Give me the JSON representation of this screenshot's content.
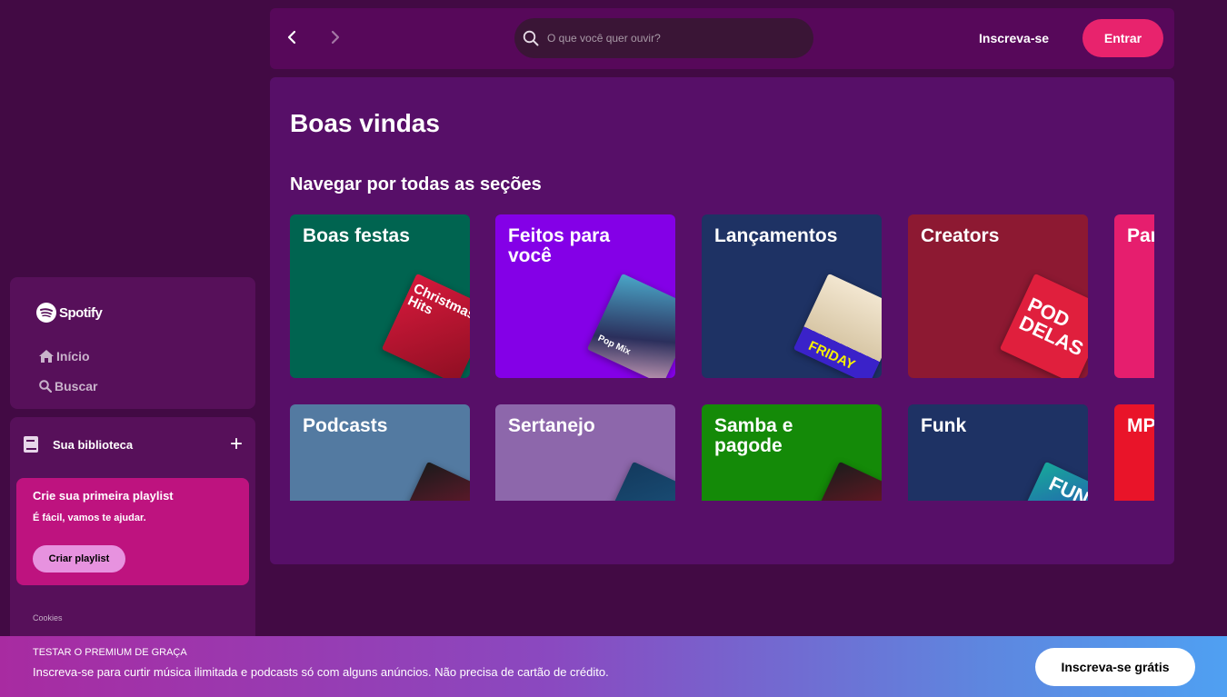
{
  "sidebar": {
    "logo_text": "Spotify",
    "nav": {
      "home": "Início",
      "search": "Buscar"
    },
    "library": {
      "title": "Sua biblioteca",
      "add": "+",
      "card": {
        "title": "Crie sua primeira playlist",
        "subtitle": "É fácil, vamos te ajudar.",
        "button": "Criar playlist"
      },
      "cookies": "Cookies"
    }
  },
  "topbar": {
    "search_placeholder": "O que você quer ouvir?",
    "signup": "Inscreva-se",
    "login": "Entrar"
  },
  "main": {
    "title": "Boas vindas",
    "section": "Navegar por todas as seções",
    "tiles": [
      {
        "label": "Boas festas",
        "color": "#006450",
        "art_text": "Christmas Hits"
      },
      {
        "label": "Feitos para você",
        "color": "#8400e7",
        "art_text": "Pop Mix"
      },
      {
        "label": "Lançamentos",
        "color": "#1e3264",
        "art_text": "FRIDAY"
      },
      {
        "label": "Creators",
        "color": "#8d1932",
        "art_text": "POD DELAS"
      },
      {
        "label": "Para",
        "color": "#e61e6e"
      },
      {
        "label": "Podcasts",
        "color": "#537aa1"
      },
      {
        "label": "Sertanejo",
        "color": "#8d67ab"
      },
      {
        "label": "Samba e pagode",
        "color": "#148a08"
      },
      {
        "label": "Funk",
        "color": "#1e3264",
        "art_text": "FUN"
      },
      {
        "label": "MPB",
        "color": "#e91429"
      }
    ]
  },
  "banner": {
    "title": "TESTAR O PREMIUM DE GRAÇA",
    "text": "Inscreva-se para curtir música ilimitada e podcasts só com alguns anúncios. Não precisa de cartão de crédito.",
    "button": "Inscreva-se grátis"
  }
}
